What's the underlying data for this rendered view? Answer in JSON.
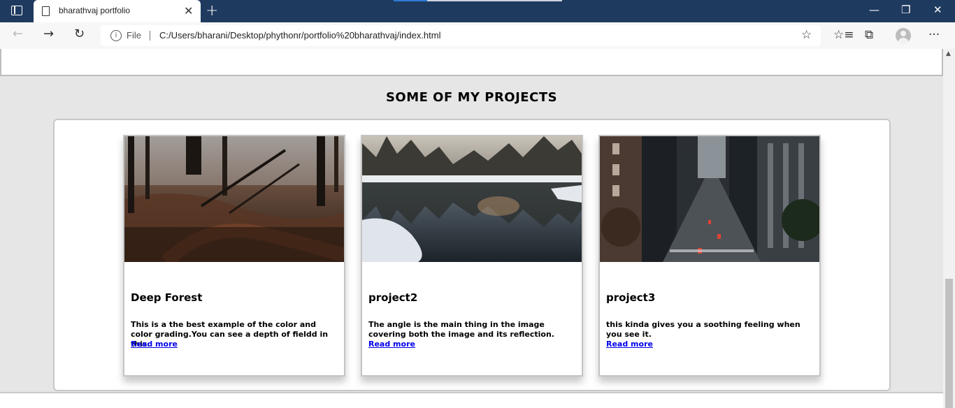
{
  "browser": {
    "tab_title": "bharathvaj portfolio",
    "tab_close": "✕",
    "new_tab": "+",
    "file_label": "File",
    "url": "C:/Users/bharani/Desktop/phythonr/portfolio%20bharathvaj/index.html",
    "icons": {
      "window_menu": "tab-actions-icon",
      "back": "←",
      "forward": "→",
      "refresh": "↻",
      "info": "i",
      "add_favorite": "☆",
      "favorites": "☆≡",
      "collections": "⧉",
      "menu": "···",
      "minimize": "—",
      "restore": "❐",
      "close": "✕",
      "scroll_up": "▲"
    },
    "colors": {
      "titlebar": "#1f3a5f",
      "link": "#0000ee"
    }
  },
  "page": {
    "section_title": "SOME OF MY PROJECTS",
    "projects": [
      {
        "title": "Deep Forest",
        "description": "This is a the best example of the color and color grading.You can see a depth of fieldd in this.",
        "link": "Read more"
      },
      {
        "title": "project2",
        "description": "The angle is the main thing in the image covering both the image and its reflection.",
        "link": "Read more"
      },
      {
        "title": "project3",
        "description": "this kinda gives you a soothing feeling when you see it.",
        "link": "Read more"
      }
    ]
  }
}
